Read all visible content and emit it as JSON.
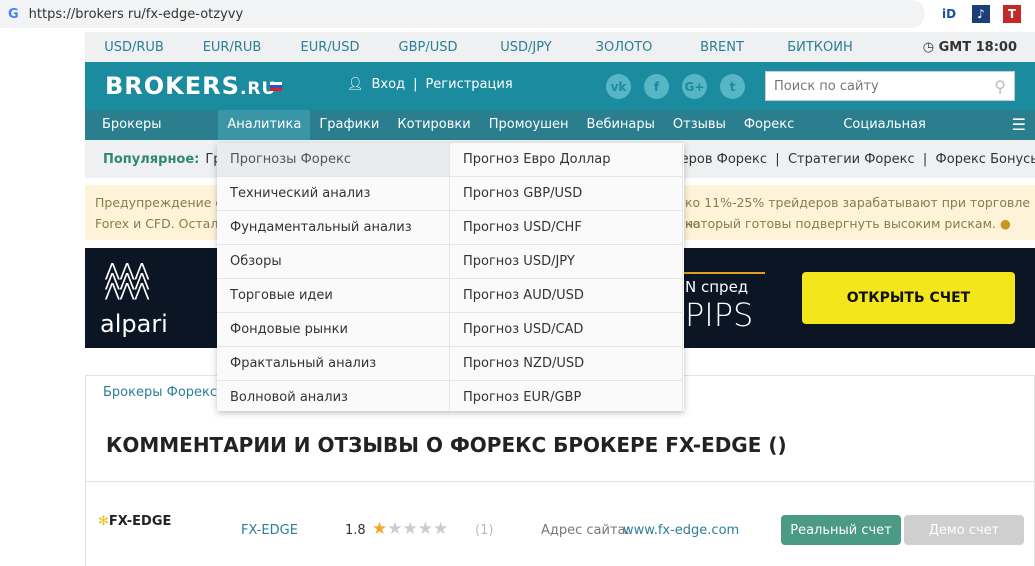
{
  "browser": {
    "url": "https://brokers ru/fx-edge-otzyvy"
  },
  "currency_bar": {
    "items": [
      "USD/RUB",
      "EUR/RUB",
      "EUR/USD",
      "GBP/USD",
      "USD/JPY",
      "ЗОЛОТО",
      "BRENT",
      "БИТКОИН"
    ],
    "time": "GMT 18:00"
  },
  "header": {
    "logo": "BROKERS",
    "logo_suffix": ".RU",
    "login": "Вход",
    "register": "Регистрация",
    "social": [
      "vk",
      "f",
      "G+",
      "t"
    ],
    "search_placeholder": "Поиск по сайту"
  },
  "nav": {
    "items": [
      "Брокеры Форекс",
      "Аналитика",
      "Графики",
      "Котировки",
      "Промоушен",
      "Вебинары",
      "Отзывы",
      "Форекс Блог",
      "Социальная торговля",
      "☰"
    ]
  },
  "popular": {
    "label": "Популярное:",
    "start": "Граф",
    "end": "еров Форекс  |  Стратегии Форекс  |  Форекс Бонусы"
  },
  "warning": {
    "line1_start": "Предупреждение о",
    "line1_end": "ко 11%-25% трейдеров зарабатывают при торговле на",
    "line2_start": "Forex и CFD. Осталь",
    "line2_end": "который готовы подвергнуть высоким рискам."
  },
  "banner": {
    "brand": "alpari",
    "spread": "N спред",
    "pips": "PIPS",
    "cta": "ОТКРЫТЬ СЧЕТ"
  },
  "dropdown": {
    "col1": [
      "Прогнозы Форекс",
      "Технический анализ",
      "Фундаментальный анализ",
      "Обзоры",
      "Торговые идеи",
      "Фондовые рынки",
      "Фрактальный анализ",
      "Волновой анализ"
    ],
    "col2": [
      "Прогноз Евро Доллар",
      "Прогноз GBP/USD",
      "Прогноз USD/CHF",
      "Прогноз USD/JPY",
      "Прогноз AUD/USD",
      "Прогноз USD/CAD",
      "Прогноз NZD/USD",
      "Прогноз EUR/GBP"
    ]
  },
  "breadcrumb": "Брокеры Форекс >",
  "page_title": "КОММЕНТАРИИ И ОТЗЫВЫ О ФОРЕКС БРОКЕРЕ FX-EDGE ()",
  "broker": {
    "logo_text": "FX-EDGE",
    "name": "FX-EDGE",
    "rating": "1.8",
    "rating_stars": 1,
    "votes": "(1)",
    "site_label": "Адрес сайта:",
    "site": "www.fx-edge.com",
    "real_btn": "Реальный счет",
    "demo_btn": "Демо счет"
  },
  "colors": {
    "teal": "#1b8ba0",
    "nav": "#2a7e8e",
    "green": "#4a9a86",
    "yellow": "#f3e61b"
  }
}
